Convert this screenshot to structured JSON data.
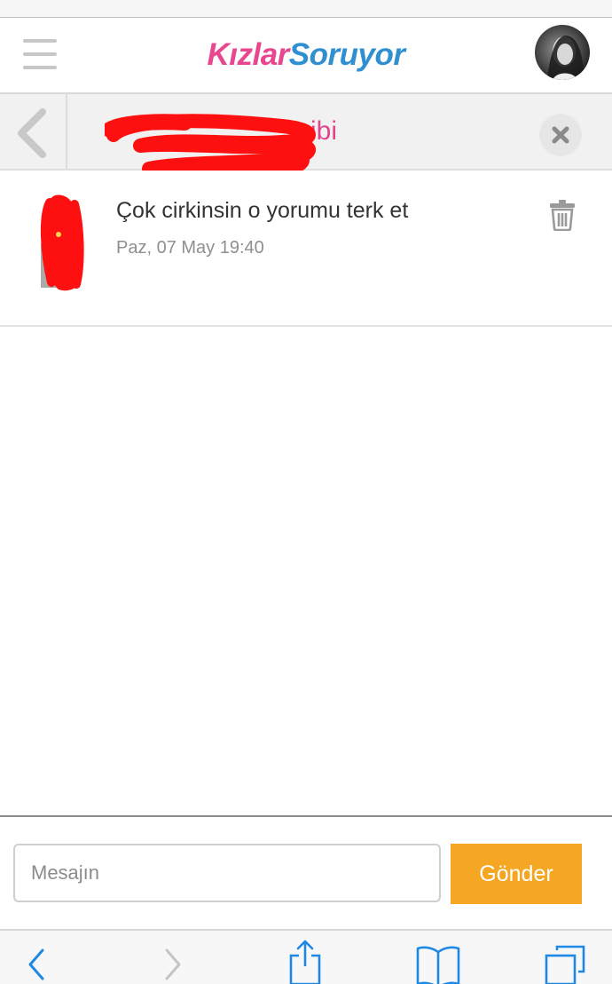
{
  "app": {
    "logo_part1": "Kızlar",
    "logo_part2": "Soruyor"
  },
  "conversation": {
    "title": "ibi"
  },
  "messages": [
    {
      "text": "Çok cirkinsin o yorumu terk et",
      "time": "Paz, 07 May 19:40"
    }
  ],
  "composer": {
    "placeholder": "Mesajın",
    "send_label": "Gönder"
  },
  "colors": {
    "brand_pink": "#e8468e",
    "brand_blue": "#2f8fd0",
    "send_orange": "#f5a623",
    "safari_blue": "#1e88e5"
  },
  "icons": {
    "menu": "hamburger-icon",
    "back": "chevron-left-icon",
    "close": "close-icon",
    "delete": "trash-icon",
    "safari_back": "chevron-left-icon",
    "safari_forward": "chevron-right-icon",
    "share": "share-icon",
    "bookmarks": "book-icon",
    "tabs": "tabs-icon"
  }
}
